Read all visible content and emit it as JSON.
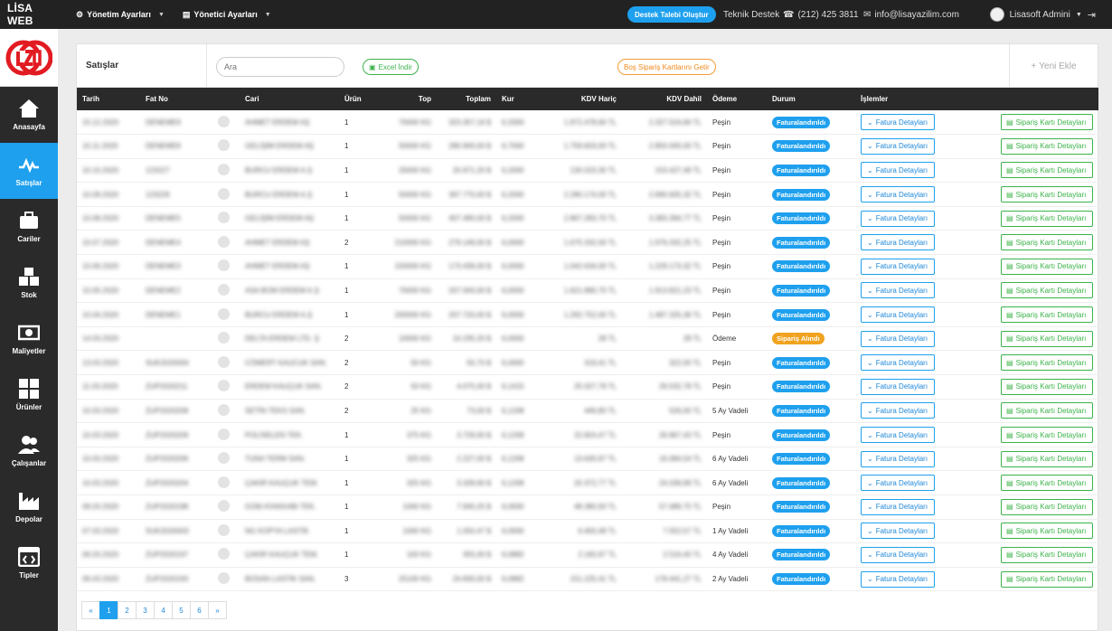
{
  "topbar": {
    "brand": "LİSA WEB",
    "menu1": "Yönetim Ayarları",
    "menu2": "Yönetici Ayarları",
    "support_button": "Destek Talebi Oluştur",
    "support_label": "Teknik Destek",
    "phone": "(212) 425 3811",
    "email": "info@lisayazilim.com",
    "user": "Lisasoft Admini"
  },
  "sidebar": {
    "items": [
      {
        "label": "Anasayfa"
      },
      {
        "label": "Satışlar"
      },
      {
        "label": "Cariler"
      },
      {
        "label": "Stok"
      },
      {
        "label": "Maliyetler"
      },
      {
        "label": "Ürünler"
      },
      {
        "label": "Çalışanlar"
      },
      {
        "label": "Depolar"
      },
      {
        "label": "Tipler"
      }
    ]
  },
  "panel": {
    "title": "Satışlar",
    "search_placeholder": "Ara",
    "excel_label": "Excel İndir",
    "empty_orders_label": "Boş Sipariş Kartlarını Getir",
    "new_label": "Yeni Ekle"
  },
  "table": {
    "headers": [
      "Tarih",
      "Fat No",
      "",
      "Cari",
      "Ürün",
      "Top",
      "Toplam",
      "Kur",
      "KDV Hariç",
      "KDV Dahil",
      "Ödeme",
      "Durum",
      "İşlemler",
      ""
    ],
    "fatura_label": "Fatura Detayları",
    "siparis_label": "Sipariş Kartı Detayları",
    "rows": [
      {
        "tarih": "15.12.2020",
        "fatno": "DENEME9",
        "cari": "AHMET ERDEM AŞ",
        "urun": "1",
        "top": "70000 KG",
        "toplam": "323.357,16 $",
        "kur": "6,3300",
        "haric": "1.972.478,60 TL",
        "dahil": "2.327.524,84 TL",
        "odeme": "Peşin",
        "durum": "Faturalandırıldı",
        "status": "blue"
      },
      {
        "tarih": "10.11.2020",
        "fatno": "DENEME8",
        "cari": "GELİŞİM ERDEM AŞ",
        "urun": "1",
        "top": "50000 KG",
        "toplam": "280.900,00 $",
        "kur": "6,7000",
        "haric": "1.759.603,00 TL",
        "dahil": "2.850.000,00 TL",
        "odeme": "Peşin",
        "durum": "Faturalandırıldı",
        "status": "blue"
      },
      {
        "tarih": "10.10.2020",
        "fatno": "123227",
        "cari": "BURCU ERDEM A.Ş",
        "urun": "1",
        "top": "20000 KG",
        "toplam": "20.971,20 $",
        "kur": "6,2000",
        "haric": "130.023,30 TL",
        "dahil": "153.427,49 TL",
        "odeme": "Peşin",
        "durum": "Faturalandırıldı",
        "status": "blue"
      },
      {
        "tarih": "10.09.2020",
        "fatno": "123226",
        "cari": "BURCU ERDEM A.Ş",
        "urun": "1",
        "top": "50000 KG",
        "toplam": "367.770,00 $",
        "kur": "6,2000",
        "haric": "2.280.174,00 TL",
        "dahil": "2.690.605,32 TL",
        "odeme": "Peşin",
        "durum": "Faturalandırıldı",
        "status": "blue"
      },
      {
        "tarih": "10.08.2020",
        "fatno": "DENEME5",
        "cari": "GELİŞİM ERDEM AŞ",
        "urun": "1",
        "top": "50000 KG",
        "toplam": "407.490,00 $",
        "kur": "6,2000",
        "haric": "2.867.283,70 TL",
        "dahil": "3.383.394,77 TL",
        "odeme": "Peşin",
        "durum": "Faturalandırıldı",
        "status": "blue"
      },
      {
        "tarih": "10.07.2020",
        "fatno": "DENEME4",
        "cari": "AHMET ERDEM AŞ",
        "urun": "2",
        "top": "210000 KG",
        "toplam": "279.149,00 $",
        "kur": "6,0000",
        "haric": "1.675.332,00 TL",
        "dahil": "1.976.332,25 TL",
        "odeme": "Peşin",
        "durum": "Faturalandırıldı",
        "status": "blue"
      },
      {
        "tarih": "10.06.2020",
        "fatno": "DENEME3",
        "cari": "AHMET ERDEM AŞ",
        "urun": "1",
        "top": "150000 KG",
        "toplam": "173.439,00 $",
        "kur": "6,0000",
        "haric": "1.042.634,00 TL",
        "dahil": "1.229.173,32 TL",
        "odeme": "Peşin",
        "durum": "Faturalandırıldı",
        "status": "blue"
      },
      {
        "tarih": "10.05.2020",
        "fatno": "DENEME2",
        "cari": "ASA BOM ERDEM A.Ş",
        "urun": "1",
        "top": "70000 KG",
        "toplam": "207.000,00 $",
        "kur": "6,0000",
        "haric": "1.621.880,70 TL",
        "dahil": "1.913.821,23 TL",
        "odeme": "Peşin",
        "durum": "Faturalandırıldı",
        "status": "blue"
      },
      {
        "tarih": "10.04.2020",
        "fatno": "DENEME1",
        "cari": "BURCU ERDEM A.Ş",
        "urun": "1",
        "top": "200000 KG",
        "toplam": "207.720,00 $",
        "kur": "6,0000",
        "haric": "1.292.752,00 TL",
        "dahil": "1.487.325,36 TL",
        "odeme": "Peşin",
        "durum": "Faturalandırıldı",
        "status": "blue"
      },
      {
        "tarih": "14.03.2020",
        "fatno": "",
        "cari": "DELTA ERDEM LTD. Ş",
        "urun": "2",
        "top": "10000 KG",
        "toplam": "10.235,20 $",
        "kur": "6,0000",
        "haric": "28 TL",
        "dahil": "28 TL",
        "odeme": "Ödeme",
        "durum": "Sipariş Alındı",
        "status": "orange"
      },
      {
        "tarih": "13.03.2020",
        "fatno": "SUK2020004",
        "cari": "CÖMERT KAUCUK SAN.",
        "urun": "2",
        "top": "50 KG",
        "toplam": "50,70 $",
        "kur": "6,0000",
        "haric": "319,41 TL",
        "dahil": "322,00 TL",
        "odeme": "Peşin",
        "durum": "Faturalandırıldı",
        "status": "blue"
      },
      {
        "tarih": "11.03.2020",
        "fatno": "ZUP2020211",
        "cari": "ERDEM KAUÇUK SAN.",
        "urun": "2",
        "top": "50 KG",
        "toplam": "4.075,00 $",
        "kur": "6,1415",
        "haric": "25.027,78 TL",
        "dahil": "29.532,78 TL",
        "odeme": "Peşin",
        "durum": "Faturalandırıldı",
        "status": "blue"
      },
      {
        "tarih": "10.03.2020",
        "fatno": "ZUP2020208",
        "cari": "SETİN TEKS SAN.",
        "urun": "2",
        "top": "25 KG",
        "toplam": "73,00 $",
        "kur": "6,1208",
        "haric": "446,80 TL",
        "dahil": "526,00 TL",
        "odeme": "5 Ay Vadeli",
        "durum": "Faturalandırıldı",
        "status": "blue"
      },
      {
        "tarih": "10.03.2020",
        "fatno": "ZUP2020209",
        "cari": "POLİSELEN TEK.",
        "urun": "1",
        "top": "375 KG",
        "toplam": "3.729,00 $",
        "kur": "6,1208",
        "haric": "22.824,47 TL",
        "dahil": "26.867,43 TL",
        "odeme": "Peşin",
        "durum": "Faturalandırıldı",
        "status": "blue"
      },
      {
        "tarih": "10.03.2020",
        "fatno": "ZUP2020206",
        "cari": "TUNA TERM SAN.",
        "urun": "1",
        "top": "325 KG",
        "toplam": "2.227,00 $",
        "kur": "6,1208",
        "haric": "13.630,97 TL",
        "dahil": "16.084,54 TL",
        "odeme": "6 Ay Vadeli",
        "durum": "Faturalandırıldı",
        "status": "blue"
      },
      {
        "tarih": "10.03.2020",
        "fatno": "ZUP2020204",
        "cari": "ÇAKIR KAUÇUK TEM.",
        "urun": "1",
        "top": "325 KG",
        "toplam": "3.328,60 $",
        "kur": "6,1208",
        "haric": "20.372,77 TL",
        "dahil": "24.039,99 TL",
        "odeme": "6 Ay Vadeli",
        "durum": "Faturalandırıldı",
        "status": "blue"
      },
      {
        "tarih": "09.03.2020",
        "fatno": "ZUP2020198",
        "cari": "GÜM AYAKKABI TEK.",
        "urun": "1",
        "top": "1000 KG",
        "toplam": "7.940,25 $",
        "kur": "6,0930",
        "haric": "48.380,93 TL",
        "dahil": "57.089,75 TL",
        "odeme": "Peşin",
        "durum": "Faturalandırıldı",
        "status": "blue"
      },
      {
        "tarih": "07.03.2020",
        "fatno": "SUK2020003",
        "cari": "NG KOPYA LASTİK",
        "urun": "1",
        "top": "1000 KG",
        "toplam": "1.050,47 $",
        "kur": "6,0930",
        "haric": "6.400,48 TL",
        "dahil": "7.552,57 TL",
        "odeme": "1 Ay Vadeli",
        "durum": "Faturalandırıldı",
        "status": "blue"
      },
      {
        "tarih": "06.03.2020",
        "fatno": "ZUP2020197",
        "cari": "ÇAKIR KAUÇUK TEM.",
        "urun": "1",
        "top": "100 KG",
        "toplam": "355,00 $",
        "kur": "6,0882",
        "haric": "2.160,97 TL",
        "dahil": "2.516,40 TL",
        "odeme": "4 Ay Vadeli",
        "durum": "Faturalandırıldı",
        "status": "blue"
      },
      {
        "tarih": "06.03.2020",
        "fatno": "ZUP2020193",
        "cari": "BÜSAN LASTİK SAN.",
        "urun": "3",
        "top": "25100 KG",
        "toplam": "24.830,00 $",
        "kur": "6,0882",
        "haric": "151.225,41 TL",
        "dahil": "178.441,27 TL",
        "odeme": "2 Ay Vadeli",
        "durum": "Faturalandırıldı",
        "status": "blue"
      }
    ]
  },
  "pagination": [
    "«",
    "1",
    "2",
    "3",
    "4",
    "5",
    "6",
    "»"
  ],
  "colors": {
    "accent": "#1ea0ee",
    "success": "#3cb34a",
    "warning": "#f0a21e",
    "dark": "#222222"
  }
}
